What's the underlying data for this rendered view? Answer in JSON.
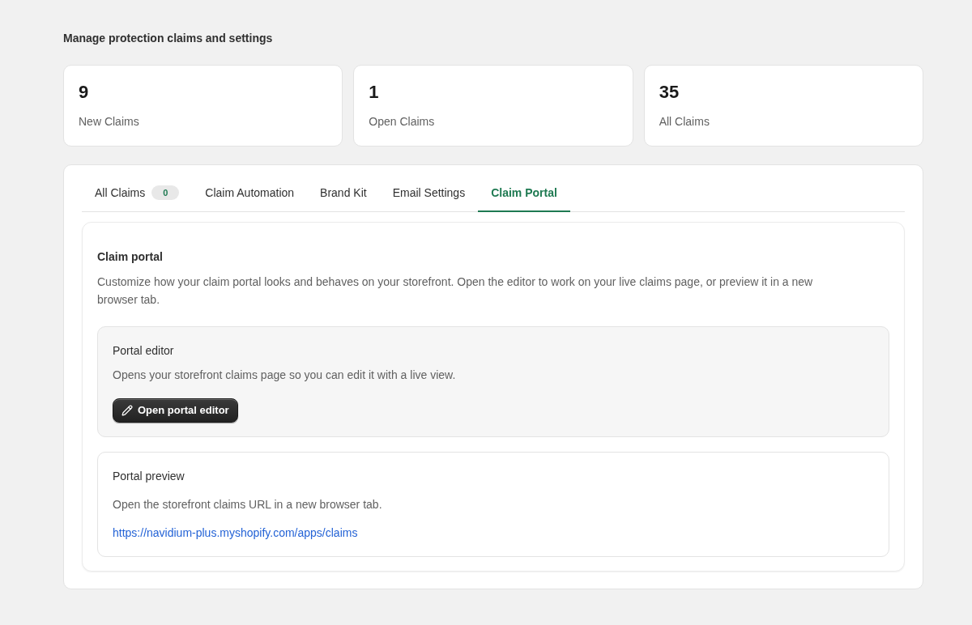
{
  "header": {
    "title": "Manage protection claims and settings"
  },
  "stats": [
    {
      "value": "9",
      "label": "New Claims"
    },
    {
      "value": "1",
      "label": "Open Claims"
    },
    {
      "value": "35",
      "label": "All Claims"
    }
  ],
  "tabs": [
    {
      "label": "All Claims",
      "badge": "0",
      "selected": false
    },
    {
      "label": "Claim Automation",
      "selected": false
    },
    {
      "label": "Brand Kit",
      "selected": false
    },
    {
      "label": "Email Settings",
      "selected": false
    },
    {
      "label": "Claim Portal",
      "selected": true
    }
  ],
  "claim_portal": {
    "title": "Claim portal",
    "description": "Customize how your claim portal looks and behaves on your storefront. Open the editor to work on your live claims page, or preview it in a new browser tab.",
    "sections": [
      {
        "kind": "editor",
        "title": "Portal editor",
        "description": "Opens your storefront claims page so you can edit it with a live view.",
        "button": {
          "label": "Open portal editor"
        }
      },
      {
        "kind": "preview",
        "title": "Portal preview",
        "description": "Open the storefront claims URL in a new browser tab.",
        "link": "https://navidium-plus.myshopify.com/apps/claims"
      }
    ]
  }
}
